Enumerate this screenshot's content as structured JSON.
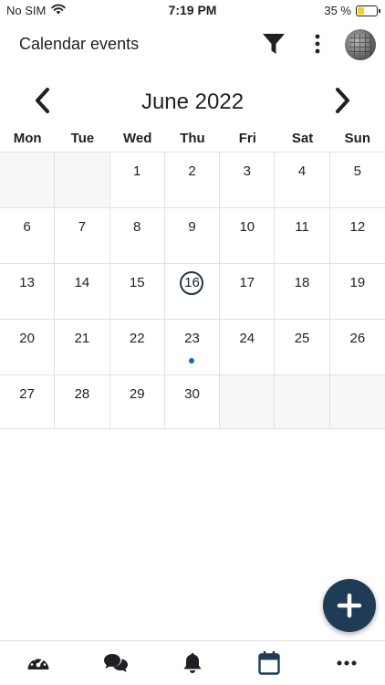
{
  "status_bar": {
    "carrier": "No SIM",
    "time": "7:19 PM",
    "battery_percent": "35 %",
    "battery_level": 0.35,
    "wifi_icon": "wifi-icon"
  },
  "header": {
    "title": "Calendar events",
    "filter_icon": "filter-icon",
    "more_icon": "more-vertical-icon",
    "avatar_icon": "user-avatar"
  },
  "calendar": {
    "month_label": "June 2022",
    "weekdays": [
      "Mon",
      "Tue",
      "Wed",
      "Thu",
      "Fri",
      "Sat",
      "Sun"
    ],
    "weeks": [
      [
        "",
        "",
        "1",
        "2",
        "3",
        "4",
        "5"
      ],
      [
        "6",
        "7",
        "8",
        "9",
        "10",
        "11",
        "12"
      ],
      [
        "13",
        "14",
        "15",
        "16",
        "17",
        "18",
        "19"
      ],
      [
        "20",
        "21",
        "22",
        "23",
        "24",
        "25",
        "26"
      ],
      [
        "27",
        "28",
        "29",
        "30",
        "",
        "",
        ""
      ]
    ],
    "today": "16",
    "days_with_events": [
      "23"
    ],
    "accent_color": "#1f3447",
    "event_dot_color": "#0f6cbf"
  },
  "fab": {
    "icon": "plus-icon",
    "color": "#1f3b55"
  },
  "bottom_nav": [
    {
      "name": "dashboard",
      "icon": "speedometer-icon"
    },
    {
      "name": "messages",
      "icon": "chat-bubbles-icon"
    },
    {
      "name": "notifications",
      "icon": "bell-icon"
    },
    {
      "name": "calendar",
      "icon": "calendar-icon",
      "active": true
    },
    {
      "name": "more",
      "icon": "more-horizontal-icon"
    }
  ]
}
